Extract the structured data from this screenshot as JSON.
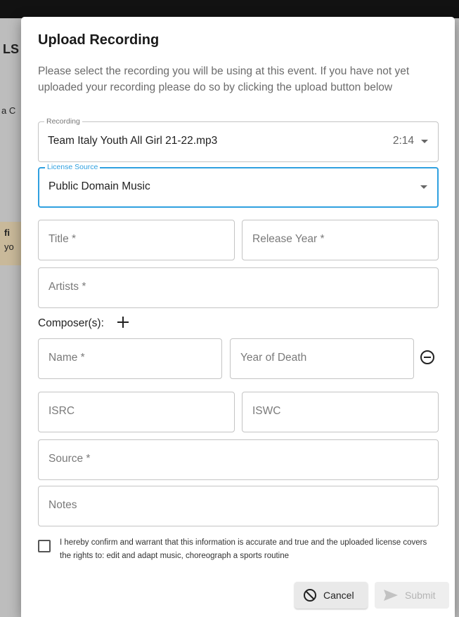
{
  "background": {
    "fragments": [
      "LS",
      "a C",
      "fi",
      "yo"
    ]
  },
  "dialog": {
    "title": "Upload Recording",
    "description": "Please select the recording you will be using at this event. If you have not yet uploaded your recording please do so by clicking the upload button below"
  },
  "recording": {
    "label": "Recording",
    "value": "Team Italy Youth All Girl 21-22.mp3",
    "duration": "2:14",
    "icon": "chevron-down-icon"
  },
  "license_source": {
    "label": "License Source",
    "value": "Public Domain Music",
    "icon": "chevron-down-icon"
  },
  "fields": {
    "title": "Title *",
    "release_year": "Release Year *",
    "artists": "Artists *",
    "composer_label": "Composer(s):",
    "composer_name": "Name *",
    "composer_year_of_death": "Year of Death",
    "isrc": "ISRC",
    "iswc": "ISWC",
    "source": "Source *",
    "notes": "Notes"
  },
  "confirm": {
    "checked": false,
    "text": "I hereby confirm and warrant that this information is accurate and true and the uploaded license covers the rights to: edit and adapt music, choreograph a sports routine"
  },
  "actions": {
    "cancel": "Cancel",
    "submit": "Submit",
    "cancel_icon": "block-icon",
    "submit_icon": "send-icon"
  },
  "colors": {
    "accent": "#2fa0e0",
    "overlay": "#7d7d7d",
    "disabled_text": "#b4b4b4"
  }
}
